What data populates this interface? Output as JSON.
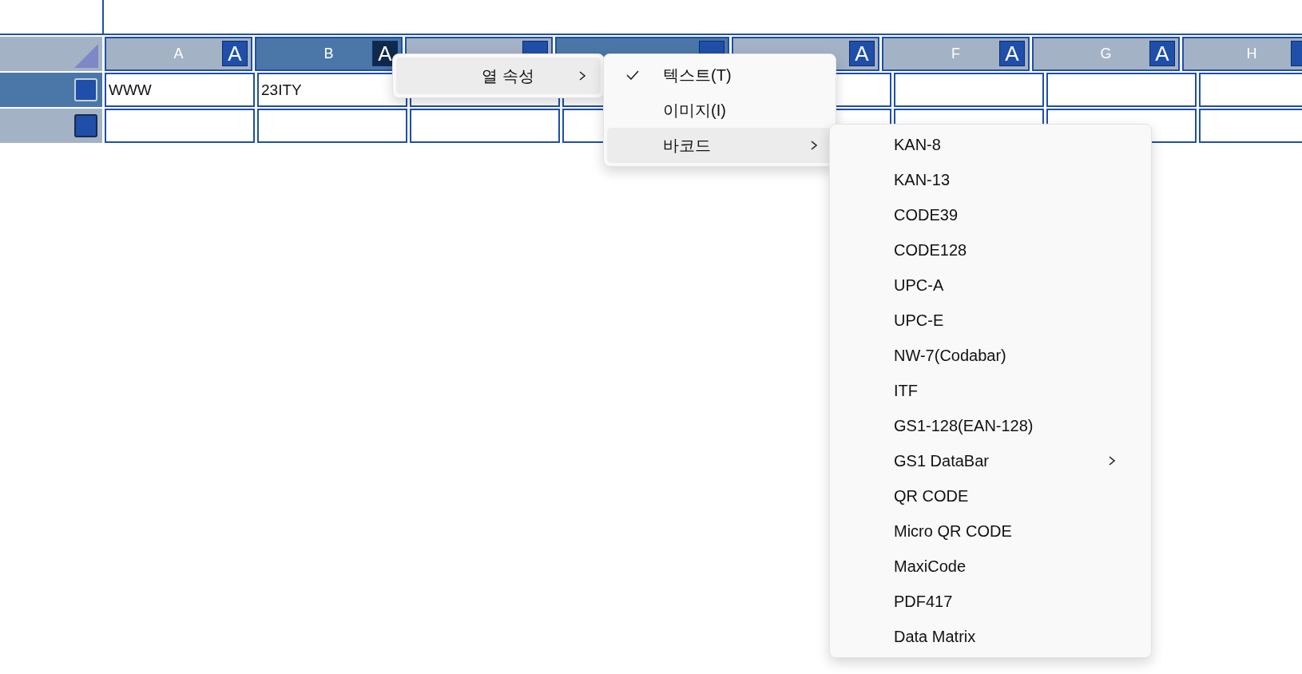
{
  "columns": [
    {
      "label": "A",
      "badge": "A",
      "badge_active": false,
      "selected": false
    },
    {
      "label": "B",
      "badge": "A",
      "badge_active": true,
      "selected": true
    },
    {
      "badge_active": false,
      "selected": false
    },
    {
      "badge_active": false,
      "selected": true
    },
    {
      "badge": "A",
      "badge_active": false,
      "selected": false
    },
    {
      "label": "F",
      "badge": "A",
      "badge_active": false,
      "selected": false
    },
    {
      "label": "G",
      "badge": "A",
      "badge_active": false,
      "selected": false
    },
    {
      "label": "H",
      "selected": false
    }
  ],
  "rows": [
    {
      "selected": true,
      "cells": [
        "WWW",
        "23ITY"
      ]
    },
    {
      "selected": false
    }
  ],
  "menu": {
    "items": [
      {
        "label": "열 속성",
        "selected": true,
        "submenu": true
      }
    ]
  },
  "submenu": {
    "items": [
      {
        "label": "텍스트(T)",
        "checked": true,
        "selected": false,
        "submenu": false
      },
      {
        "label": "이미지(I)",
        "checked": false,
        "selected": false,
        "submenu": false
      },
      {
        "label": "바코드",
        "checked": false,
        "selected": true,
        "submenu": true
      }
    ]
  },
  "barcode_menu": {
    "items": [
      {
        "label": "KAN-8",
        "submenu": false
      },
      {
        "label": "KAN-13",
        "submenu": false
      },
      {
        "label": "CODE39",
        "submenu": false
      },
      {
        "label": "CODE128",
        "submenu": false
      },
      {
        "label": "UPC-A",
        "submenu": false
      },
      {
        "label": "UPC-E",
        "submenu": false
      },
      {
        "label": "NW-7(Codabar)",
        "submenu": false
      },
      {
        "label": "ITF",
        "submenu": false
      },
      {
        "label": "GS1-128(EAN-128)",
        "submenu": false
      },
      {
        "label": "GS1 DataBar",
        "submenu": true
      },
      {
        "label": "QR CODE",
        "submenu": false
      },
      {
        "label": "Micro QR CODE",
        "submenu": false
      },
      {
        "label": "MaxiCode",
        "submenu": false
      },
      {
        "label": "PDF417",
        "submenu": false
      },
      {
        "label": "Data Matrix",
        "submenu": false
      }
    ]
  }
}
